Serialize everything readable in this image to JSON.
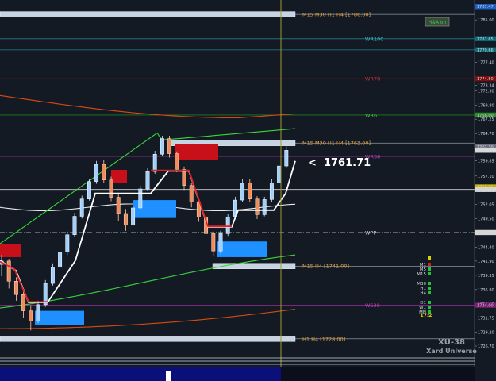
{
  "chart_data": {
    "type": "candlestick",
    "symbol_id": "XU-38",
    "brand": "Xard Universe",
    "current_price_label": "<  1761.71",
    "price_axis": {
      "min": 1725,
      "max": 1788,
      "ticks": [
        "1785.00",
        "1781.65",
        "1779.66",
        "1777.40",
        "1773.34",
        "1772.30",
        "1769.80",
        "1767.25",
        "1764.70",
        "1762.15",
        "1759.85",
        "1757.10",
        "1754.50",
        "1752.05",
        "1749.50",
        "1747.00",
        "1744.40",
        "1741.90",
        "1739.35",
        "1736.80",
        "1734.25",
        "1731.75",
        "1729.20",
        "1726.70"
      ]
    },
    "price_tags": [
      {
        "price": 1787.4,
        "text": "1787.47",
        "color": "#2060c0"
      },
      {
        "price": 1781.65,
        "text": "1781.65",
        "color": "#0e6b78"
      },
      {
        "price": 1779.66,
        "text": "1779.66",
        "color": "#0e6b78"
      },
      {
        "price": 1774.5,
        "text": "1774.50",
        "color": "#7a1010"
      },
      {
        "price": 1768.0,
        "text": "1768.00",
        "color": "#2f8a2f"
      },
      {
        "price": 1762.3,
        "text": "1762.30",
        "color": "#707080"
      },
      {
        "price": 1761.71,
        "text": "1761.71",
        "color": "#d9d9d9"
      },
      {
        "price": 1755.15,
        "text": "1755.15",
        "color": "#c9b000"
      },
      {
        "price": 1754.7,
        "text": "1754.70",
        "color": "#d7d7d7"
      },
      {
        "price": 1747.0,
        "text": "1747.01",
        "color": "#d7d7d7"
      },
      {
        "price": 1734.0,
        "text": "1734.00",
        "color": "#7a2070"
      }
    ],
    "levels": [
      {
        "name": "M15 M30 H1 H4  [1786.00]",
        "price": 1786.0,
        "color": "#e8a33c",
        "bar_from": 0,
        "bar_to": 372
      },
      {
        "name": "WR100",
        "price": 1781.65,
        "color": "#39c2d7",
        "line": "#1f6f78"
      },
      {
        "name": "",
        "price": 1779.66,
        "color": "#39c2d7",
        "line": "#1f6f78"
      },
      {
        "name": "WR78",
        "price": 1774.5,
        "color": "#c83232",
        "line": "#7a1515"
      },
      {
        "name": "WR61",
        "price": 1768.0,
        "color": "#3fcf3f",
        "line": "#1f7a1f"
      },
      {
        "name": "M15 M30 H1 H4  [1763.00]",
        "price": 1763.0,
        "color": "#e8a33c",
        "bar_from": 213,
        "bar_to": 372
      },
      {
        "name": "WR38",
        "price": 1760.6,
        "color": "#c040c0",
        "line": "#8a2a8a"
      },
      {
        "name": "",
        "price": 1755.15,
        "color": "#c9b000",
        "line": "#8a7a00"
      },
      {
        "name": "",
        "price": 1754.7,
        "color": "#d7d7d7",
        "line": "#cfcfcf"
      },
      {
        "name": "WPP",
        "price": 1747.0,
        "color": "#d7d7d7",
        "line": "#aaaaaa"
      },
      {
        "name": "M15 H4  [1741.00]",
        "price": 1741.0,
        "color": "#e8a33c",
        "bar_from": 268,
        "bar_to": 372
      },
      {
        "name": "WS38",
        "price": 1734.0,
        "color": "#c040c0",
        "line": "#8a2a8a"
      },
      {
        "name": "H1 H4  [1728.00]",
        "price": 1728.0,
        "color": "#e8a33c",
        "bar_from": 0,
        "bar_to": 372
      }
    ],
    "candles": [
      [
        1741.3,
        1743.0,
        1739.2,
        1741.9
      ],
      [
        1741.9,
        1742.3,
        1737.0,
        1738.3
      ],
      [
        1738.3,
        1739.0,
        1734.8,
        1735.9
      ],
      [
        1735.9,
        1736.6,
        1731.8,
        1733.0
      ],
      [
        1733.0,
        1734.0,
        1729.5,
        1731.2
      ],
      [
        1731.2,
        1734.8,
        1730.8,
        1734.1
      ],
      [
        1734.1,
        1738.5,
        1733.7,
        1737.9
      ],
      [
        1737.9,
        1741.5,
        1737.5,
        1740.8
      ],
      [
        1740.8,
        1744.0,
        1740.2,
        1743.5
      ],
      [
        1743.5,
        1747.2,
        1743.0,
        1746.6
      ],
      [
        1746.6,
        1750.5,
        1746.2,
        1749.9
      ],
      [
        1749.9,
        1753.6,
        1749.5,
        1753.0
      ],
      [
        1753.0,
        1756.6,
        1752.7,
        1756.1
      ],
      [
        1756.1,
        1759.8,
        1755.7,
        1759.2
      ],
      [
        1759.2,
        1760.0,
        1755.8,
        1756.4
      ],
      [
        1756.4,
        1757.0,
        1752.6,
        1753.3
      ],
      [
        1753.3,
        1754.0,
        1749.1,
        1750.4
      ],
      [
        1750.4,
        1751.2,
        1747.3,
        1748.3
      ],
      [
        1748.3,
        1752.0,
        1747.9,
        1751.4
      ],
      [
        1751.4,
        1755.4,
        1751.0,
        1754.8
      ],
      [
        1754.8,
        1758.5,
        1754.4,
        1757.9
      ],
      [
        1757.9,
        1761.6,
        1757.5,
        1761.0
      ],
      [
        1761.0,
        1764.3,
        1760.6,
        1763.8
      ],
      [
        1763.8,
        1764.3,
        1760.4,
        1761.1
      ],
      [
        1761.1,
        1761.5,
        1757.8,
        1758.3
      ],
      [
        1758.3,
        1758.8,
        1754.6,
        1755.4
      ],
      [
        1755.4,
        1755.9,
        1751.5,
        1752.5
      ],
      [
        1752.5,
        1753.0,
        1748.9,
        1749.8
      ],
      [
        1749.8,
        1750.3,
        1745.5,
        1746.8
      ],
      [
        1746.8,
        1747.2,
        1742.8,
        1743.7
      ],
      [
        1743.7,
        1747.3,
        1743.2,
        1746.8
      ],
      [
        1746.8,
        1750.3,
        1746.4,
        1749.8
      ],
      [
        1749.8,
        1753.4,
        1749.4,
        1752.8
      ],
      [
        1752.8,
        1756.5,
        1752.4,
        1755.9
      ],
      [
        1755.9,
        1756.5,
        1752.4,
        1753.0
      ],
      [
        1753.0,
        1753.5,
        1749.4,
        1750.2
      ],
      [
        1750.2,
        1753.4,
        1749.9,
        1752.9
      ],
      [
        1752.9,
        1756.5,
        1752.5,
        1755.9
      ],
      [
        1755.9,
        1759.4,
        1755.5,
        1758.9
      ],
      [
        1758.9,
        1762.4,
        1758.5,
        1761.7
      ]
    ],
    "side_panel": {
      "badge": "H&A on",
      "timeframes": [
        "M1",
        "M5",
        "M15",
        "M30",
        "H1",
        "H4",
        "D1",
        "W1",
        "MN"
      ],
      "counter": "17:2"
    }
  }
}
